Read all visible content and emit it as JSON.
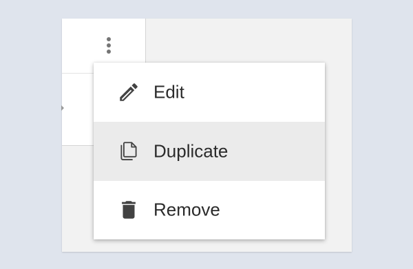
{
  "row_card": {
    "more_icon": "more-vert-icon",
    "expand_icon": "chevron-right-icon"
  },
  "menu": {
    "items": [
      {
        "label": "Edit",
        "icon": "pencil-icon",
        "highlighted": false
      },
      {
        "label": "Duplicate",
        "icon": "copy-icon",
        "highlighted": true
      },
      {
        "label": "Remove",
        "icon": "trash-icon",
        "highlighted": false
      }
    ]
  },
  "colors": {
    "background": "#dfe4ed",
    "panel": "#f2f2f2",
    "menu": "#ffffff",
    "highlight": "#ebebeb",
    "icon": "#424242",
    "text": "#2b2b2b"
  }
}
